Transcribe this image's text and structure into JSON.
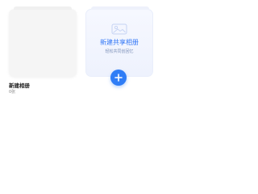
{
  "albums": [
    {
      "name": "新建相册",
      "count": "0张"
    }
  ],
  "shared_album": {
    "title": "新建共享相册",
    "subtitle": "轻松共同创回忆",
    "icon": "photo-icon",
    "add_icon": "plus-icon"
  },
  "colors": {
    "accent": "#3478f6",
    "button": "#2f7df6",
    "card_bg": "#f5f5f5",
    "shared_bg": "#eef2fd"
  }
}
